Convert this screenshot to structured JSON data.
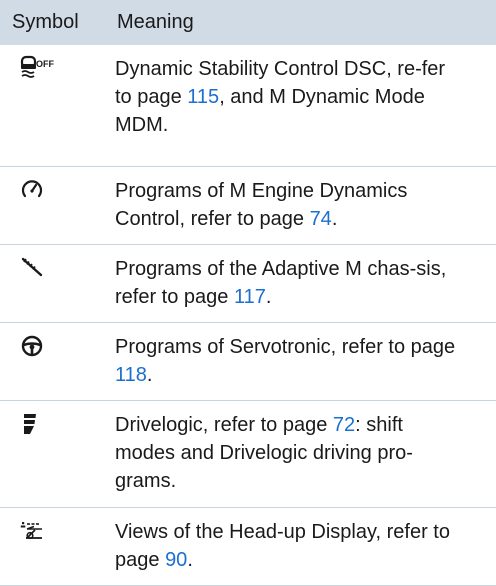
{
  "header": {
    "symbol_label": "Symbol",
    "meaning_label": "Meaning"
  },
  "rows": [
    {
      "icon": "dsc-off-icon",
      "icon_text": "OFF",
      "before": "Dynamic Stability Control DSC, re-fer to page ",
      "page": "115",
      "after": ", and M Dynamic Mode MDM."
    },
    {
      "icon": "gauge-icon",
      "before": "Programs of M Engine Dynamics Control, refer to page ",
      "page": "74",
      "after": "."
    },
    {
      "icon": "shock-absorber-icon",
      "before": "Programs of the Adaptive M chas-sis, refer to page ",
      "page": "117",
      "after": "."
    },
    {
      "icon": "steering-wheel-icon",
      "before": "Programs of Servotronic, refer to page ",
      "page": "118",
      "after": "."
    },
    {
      "icon": "drivelogic-icon",
      "before": "Drivelogic, refer to page ",
      "page": "72",
      "after": ": shift modes and Drivelogic driving pro-grams."
    },
    {
      "icon": "head-up-display-icon",
      "before": "Views of the Head-up Display, refer to page ",
      "page": "90",
      "after": "."
    }
  ]
}
